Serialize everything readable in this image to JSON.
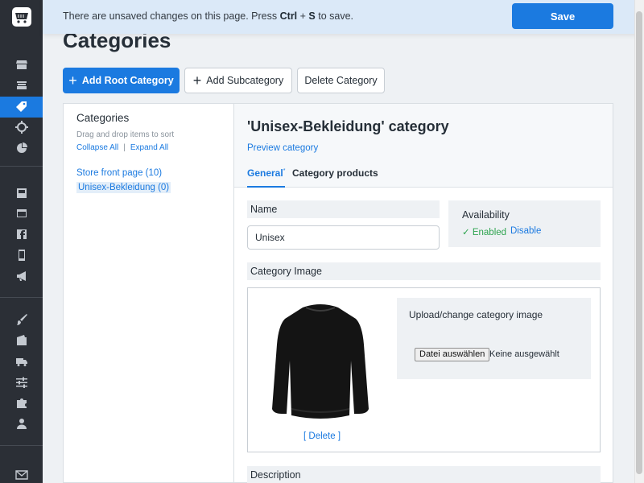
{
  "banner": {
    "text_before": "There are unsaved changes on this page. Press ",
    "key_ctrl": "Ctrl",
    "key_plus": " + ",
    "key_s": "S",
    "text_after": " to save.",
    "save_label": "Save"
  },
  "page": {
    "title": "Categories"
  },
  "toolbar": {
    "plus": "+",
    "add_root_label": "Add Root Category",
    "add_sub_label": "Add Subcategory",
    "delete_label": "Delete Category"
  },
  "tree_panel": {
    "title": "Categories",
    "hint": "Drag and drop items to sort",
    "collapse_all": "Collapse All",
    "separator": "|",
    "expand_all": "Expand All",
    "items": [
      {
        "label": "Store front page (10)"
      },
      {
        "label": "Unisex-Bekleidung (0)"
      }
    ]
  },
  "editor": {
    "title": "'Unisex-Bekleidung' category",
    "preview_link": "Preview category",
    "tabs": [
      {
        "label": "General",
        "marker": "*"
      },
      {
        "label": "Category products"
      }
    ],
    "name_label": "Name",
    "name_value": "Unisex",
    "availability_label": "Availability",
    "availability_status": "Enabled",
    "availability_check": "✓",
    "disable_label": "Disable",
    "image_label": "Category Image",
    "image_delete": "[ Delete ]",
    "upload_title": "Upload/change category image",
    "file_button": "Datei auswählen",
    "file_status": "Keine ausgewählt",
    "description_label": "Description"
  },
  "colors": {
    "accent": "#1b7ae0",
    "sidebar_bg": "#2b2f36",
    "banner_bg": "#dbe9f8",
    "enabled_green": "#2ea44f"
  },
  "sidebar": {
    "icons": [
      "logo-icon",
      "store-icon",
      "catalog-icon",
      "tag-icon",
      "target-icon",
      "pie-chart-icon",
      "storage-icon",
      "website-icon",
      "facebook-icon",
      "mobile-icon",
      "megaphone-icon",
      "brush-icon",
      "wallet-icon",
      "truck-icon",
      "sliders-icon",
      "puzzle-icon",
      "user-icon",
      "mail-icon"
    ]
  }
}
